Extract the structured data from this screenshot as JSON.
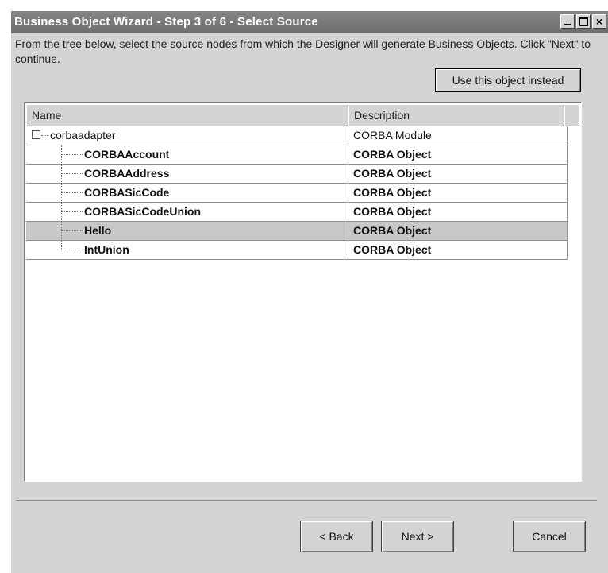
{
  "window": {
    "title": "Business Object Wizard - Step 3 of 6 - Select Source",
    "controls": {
      "minimize": "minimize",
      "maximize": "maximize",
      "close": "×"
    }
  },
  "instructions": "From the tree below, select the source nodes from which the Designer will generate Business Objects. Click \"Next\" to continue.",
  "use_object_button": "Use this object instead",
  "table": {
    "columns": [
      "Name",
      "Description"
    ],
    "root": {
      "expander": "−",
      "name": "corbaadapter",
      "description": "CORBA Module"
    },
    "children": [
      {
        "name": "CORBAAccount",
        "description": "CORBA Object"
      },
      {
        "name": "CORBAAddress",
        "description": "CORBA Object"
      },
      {
        "name": "CORBASicCode",
        "description": "CORBA Object"
      },
      {
        "name": "CORBASicCodeUnion",
        "description": "CORBA Object"
      },
      {
        "name": "Hello",
        "description": "CORBA Object",
        "selected": true
      },
      {
        "name": "IntUnion",
        "description": "CORBA Object"
      }
    ]
  },
  "buttons": {
    "back": "< Back",
    "next": "Next >",
    "cancel": "Cancel"
  },
  "colors": {
    "titlebar": "#767676",
    "dialog": "#d4d4d4",
    "selected_row": "#c8c8c8"
  }
}
